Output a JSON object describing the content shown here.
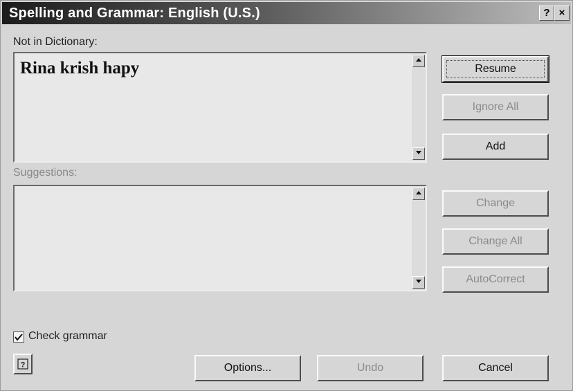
{
  "window": {
    "title": "Spelling and Grammar: English (U.S.)",
    "help_glyph": "?",
    "close_glyph": "×"
  },
  "not_in_dictionary": {
    "label": "Not in Dictionary:",
    "text": "Rina krish hapy"
  },
  "suggestions": {
    "label": "Suggestions:",
    "items": []
  },
  "buttons": {
    "resume": "Resume",
    "ignore_all": "Ignore All",
    "add": "Add",
    "change": "Change",
    "change_all": "Change All",
    "autocorrect": "AutoCorrect",
    "options": "Options...",
    "undo": "Undo",
    "cancel": "Cancel"
  },
  "check_grammar": {
    "label": "Check grammar",
    "checked": true
  },
  "icons": {
    "help": "help-icon",
    "scroll_up": "arrow-up-icon",
    "scroll_down": "arrow-down-icon",
    "checkmark": "checkmark-icon"
  }
}
